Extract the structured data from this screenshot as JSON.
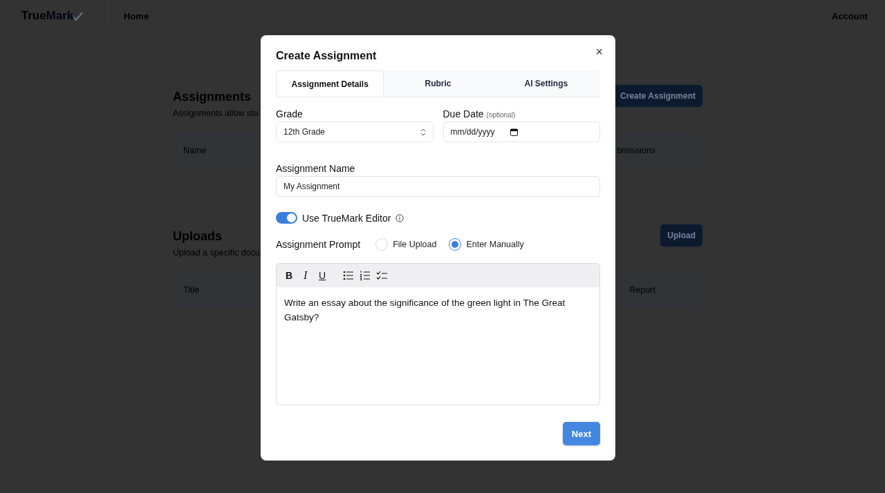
{
  "navbar": {
    "logo": {
      "dark": "True",
      "accent": "Mark"
    },
    "links": [
      {
        "label": "Home"
      }
    ],
    "account": "Account"
  },
  "page": {
    "sections": [
      {
        "title": "Assignments",
        "description": "Assignments allow stu",
        "button": "Create Assignment",
        "columns": [
          "Name",
          "bmissions"
        ]
      },
      {
        "title": "Uploads",
        "description": "Upload a specific docu",
        "button": "Upload",
        "columns": [
          "Title",
          "Report"
        ]
      }
    ]
  },
  "dialog": {
    "title": "Create Assignment",
    "close": "×",
    "tabs": [
      {
        "label": "Assignment Details",
        "selected": true
      },
      {
        "label": "Rubric",
        "selected": false
      },
      {
        "label": "AI Settings",
        "selected": false
      }
    ],
    "grade": {
      "label": "Grade",
      "value": "12th Grade"
    },
    "due_date": {
      "label": "Due Date",
      "hint": "(optional)",
      "value": "mm/dd/yyyy"
    },
    "name": {
      "label": "Assignment Name",
      "value": "My Assignment"
    },
    "editor_toggle": {
      "label": "Use TrueMark Editor",
      "on": true
    },
    "prompt": {
      "label": "Assignment Prompt",
      "options": [
        {
          "label": "File Upload",
          "selected": false
        },
        {
          "label": "Enter Manually",
          "selected": true
        }
      ]
    },
    "editor": {
      "toolbar": [
        {
          "kind": "bold",
          "label": "B"
        },
        {
          "kind": "italic",
          "label": "I"
        },
        {
          "kind": "underline",
          "label": "U"
        },
        {
          "kind": "bullets"
        },
        {
          "kind": "numbers"
        },
        {
          "kind": "checklist"
        }
      ],
      "text": "Write an essay about the significance of the green light in The Great Gatsby?"
    },
    "next": "Next"
  }
}
